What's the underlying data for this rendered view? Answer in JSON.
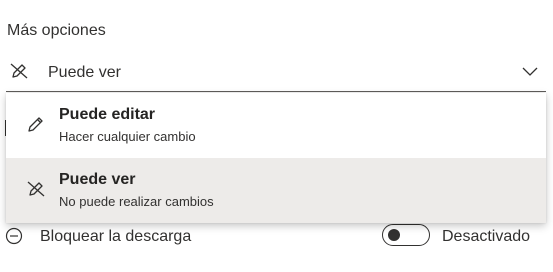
{
  "section": {
    "title": "Más opciones"
  },
  "permission_select": {
    "value": "Puede ver",
    "icon": "no-edit-pencil-icon",
    "chevron_icon": "chevron-down-icon"
  },
  "dropdown": {
    "options": [
      {
        "title": "Puede editar",
        "description": "Hacer cualquier cambio",
        "icon": "pencil-icon",
        "selected": false
      },
      {
        "title": "Puede ver",
        "description": "No puede realizar cambios",
        "icon": "no-edit-pencil-icon",
        "selected": true
      }
    ]
  },
  "block_download": {
    "label": "Bloquear la descarga",
    "icon": "minus-circle-icon",
    "toggle_on": false,
    "state_label": "Desactivado"
  }
}
